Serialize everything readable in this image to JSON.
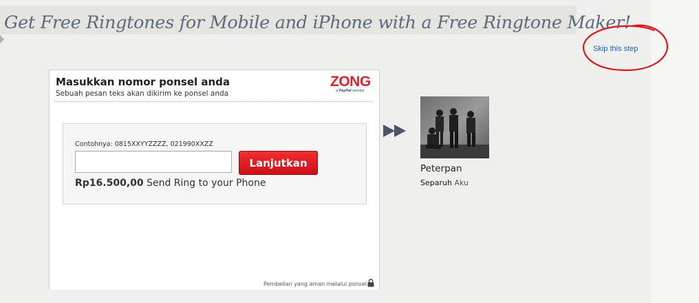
{
  "banner": {
    "title": "Get Free Ringtones for Mobile and iPhone with a Free Ringtone Maker!"
  },
  "skip": {
    "label": "Skip this step"
  },
  "panel": {
    "title": "Masukkan nomor ponsel anda",
    "subtitle": "Sebuah pesan teks akan dikirim ke ponsel anda",
    "logo": {
      "word": "ZONG",
      "sub_prefix": "a",
      "sub_brand": "PayPal",
      "sub_suffix": "service"
    },
    "form": {
      "example_label": "Contohnya: 0815XXYYZZZZ, 021990XXZZ",
      "input_value": "",
      "input_placeholder": "",
      "submit_label": "Lanjutkan",
      "price": "Rp16.500,00",
      "price_suffix": " Send Ring to your Phone"
    },
    "secure_note": "Pembelian yang aman melalui ponsel"
  },
  "product": {
    "artist": "Peterpan",
    "song_title": "Separuh",
    "song_rest": " Aku"
  },
  "colors": {
    "accent_red": "#d8252c",
    "link_blue": "#2563b8",
    "banner_text": "#5d6a7c",
    "annotation_circle": "#e0141b"
  },
  "icons": {
    "arrow": "double-right-arrow-icon",
    "lock": "lock-icon"
  }
}
